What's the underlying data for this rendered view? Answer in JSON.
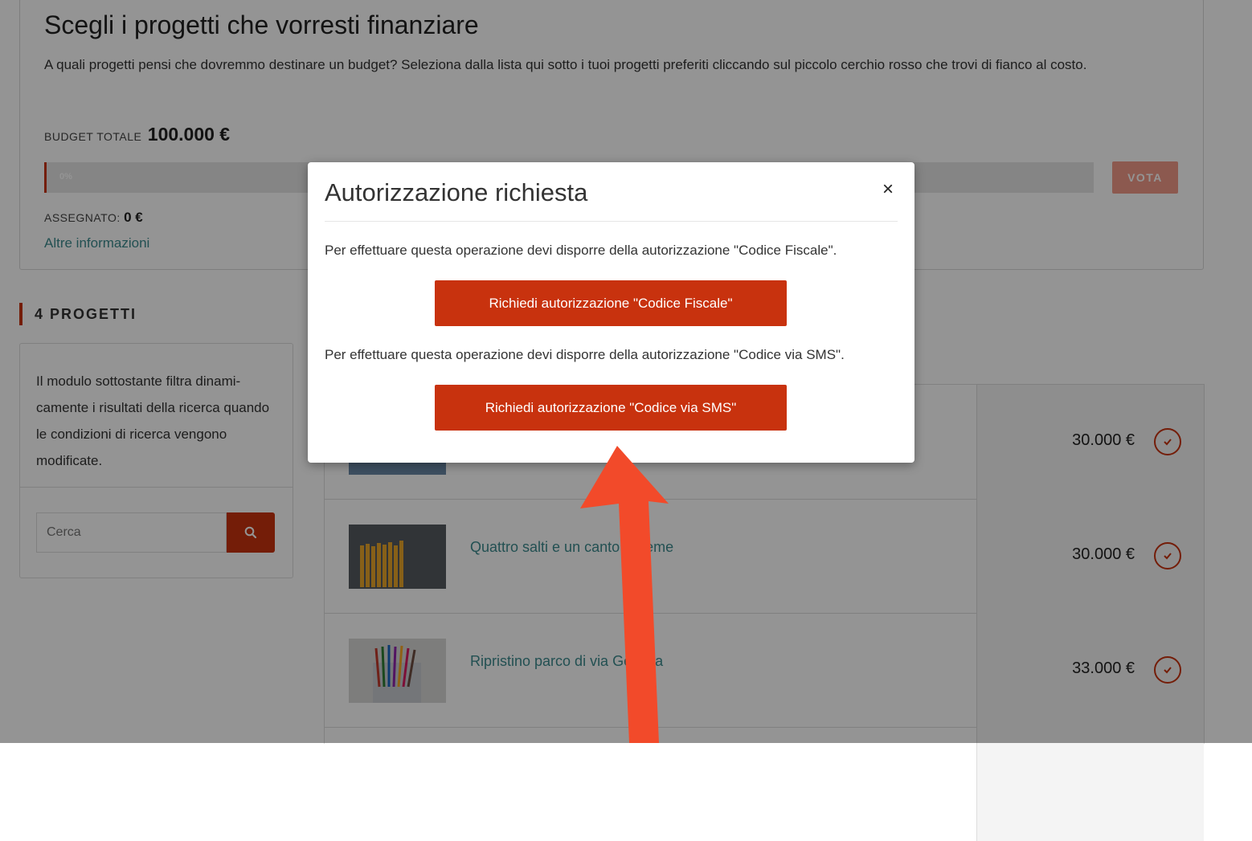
{
  "intro": {
    "title": "Scegli i progetti che vorresti finanziare",
    "description": "A quali progetti pensi che dovremmo destinare un budget? Seleziona dalla lista qui sotto i tuoi progetti preferiti cliccando sul piccolo cerchio rosso che trovi di fianco al costo.",
    "budget_label": "BUDGET TOTALE",
    "budget_value": "100.000 €",
    "progress_text": "0%",
    "progress_fraction": 0,
    "vote_label": "VOTA",
    "assigned_label": "ASSEGNATO:",
    "assigned_value": "0 €",
    "more_info": "Altre informazioni"
  },
  "projects_heading": "4 PROGETTI",
  "filter": {
    "description": "Il modulo sottostante filtra dinami­camente i risultati della ricerca quando le condizioni di ricerca vengono modificate.",
    "search_placeholder": "Cerca",
    "search_icon": "search-icon"
  },
  "projects": [
    {
      "title": "",
      "cost": "30.000 €"
    },
    {
      "title": "Quattro salti e un canto insieme",
      "cost": "30.000 €"
    },
    {
      "title": "Ripristino parco di via Genova",
      "cost": "33.000 €"
    }
  ],
  "modal": {
    "title": "Autorizzazione richiesta",
    "close": "×",
    "text_fiscal": "Per effettuare questa operazione devi disporre della autorizzazione \"Codice Fiscale\".",
    "button_fiscal": "Richiedi autorizzazione \"Codice Fiscale\"",
    "text_sms": "Per effettuare questa operazione devi disporre della autorizzazione \"Codice via SMS\".",
    "button_sms": "Richiedi autorizzazione \"Codice via SMS\""
  },
  "colors": {
    "accent": "#c8320e",
    "link": "#3c8a8e",
    "annotation_arrow": "#f24a2a"
  }
}
